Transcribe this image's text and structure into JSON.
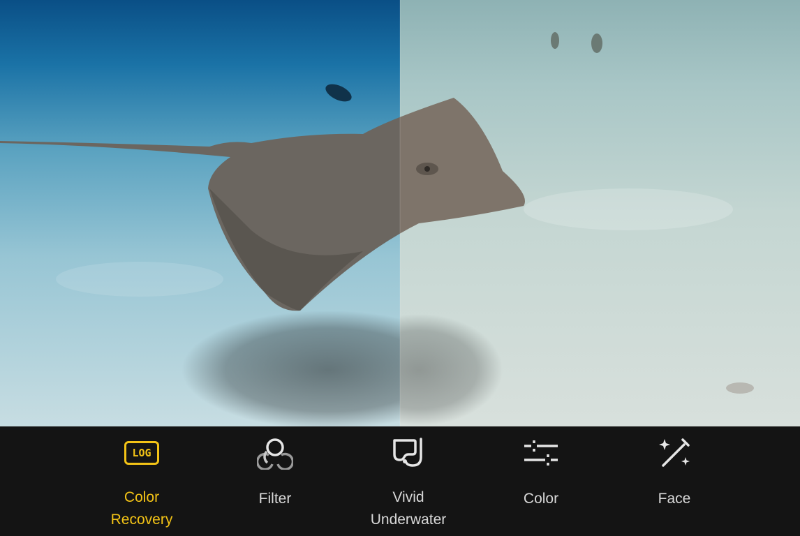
{
  "preview": {
    "subject": "stingray-photo",
    "left_half": "color-recovered",
    "right_half": "original"
  },
  "toolbar": {
    "accent_color": "#f3c316",
    "items": [
      {
        "id": "color-recovery",
        "icon": "log-badge-icon",
        "icon_text": "LOG",
        "label_line1": "Color",
        "label_line2": "Recovery",
        "active": true
      },
      {
        "id": "filter",
        "icon": "filter-circles-icon",
        "label_line1": "Filter",
        "label_line2": "",
        "active": false
      },
      {
        "id": "vivid-underwater",
        "icon": "snorkel-mask-icon",
        "label_line1": "Vivid",
        "label_line2": "Underwater",
        "active": false
      },
      {
        "id": "color",
        "icon": "sliders-icon",
        "label_line1": "Color",
        "label_line2": "",
        "active": false
      },
      {
        "id": "face",
        "icon": "magic-wand-icon",
        "label_line1": "Face",
        "label_line2": "",
        "active": false
      }
    ]
  }
}
